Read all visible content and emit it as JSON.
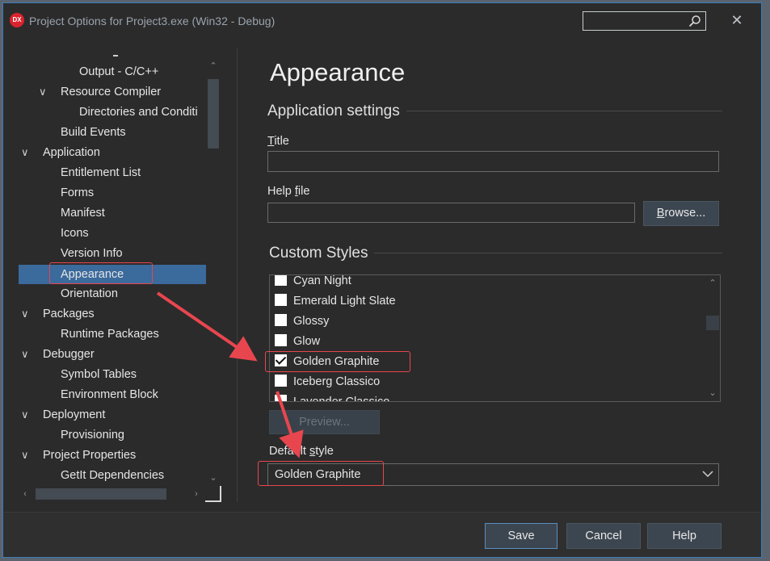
{
  "window": {
    "title": "Project Options for Project3.exe  (Win32 - Debug)",
    "app_icon_text": "DX",
    "close_symbol": "✕"
  },
  "tree": {
    "items": [
      {
        "label": "Output - C/C++",
        "level": 2,
        "expanded": null
      },
      {
        "label": "Resource Compiler",
        "level": 1,
        "expanded": true
      },
      {
        "label": "Directories and Conditi",
        "level": 2,
        "expanded": null
      },
      {
        "label": "Build Events",
        "level": 1,
        "expanded": null
      },
      {
        "label": "Application",
        "level": 0,
        "expanded": true
      },
      {
        "label": "Entitlement List",
        "level": 1,
        "expanded": null
      },
      {
        "label": "Forms",
        "level": 1,
        "expanded": null
      },
      {
        "label": "Manifest",
        "level": 1,
        "expanded": null
      },
      {
        "label": "Icons",
        "level": 1,
        "expanded": null
      },
      {
        "label": "Version Info",
        "level": 1,
        "expanded": null
      },
      {
        "label": "Appearance",
        "level": 1,
        "expanded": null,
        "selected": true
      },
      {
        "label": "Orientation",
        "level": 1,
        "expanded": null
      },
      {
        "label": "Packages",
        "level": 0,
        "expanded": true
      },
      {
        "label": "Runtime Packages",
        "level": 1,
        "expanded": null
      },
      {
        "label": "Debugger",
        "level": 0,
        "expanded": true
      },
      {
        "label": "Symbol Tables",
        "level": 1,
        "expanded": null
      },
      {
        "label": "Environment Block",
        "level": 1,
        "expanded": null
      },
      {
        "label": "Deployment",
        "level": 0,
        "expanded": true
      },
      {
        "label": "Provisioning",
        "level": 1,
        "expanded": null
      },
      {
        "label": "Project Properties",
        "level": 0,
        "expanded": true
      },
      {
        "label": "GetIt Dependencies",
        "level": 1,
        "expanded": null
      }
    ]
  },
  "main": {
    "heading": "Appearance",
    "app_settings": {
      "group_label": "Application settings",
      "title_label_accel": "T",
      "title_label_rest": "itle",
      "title_value": "",
      "helpfile_label_pre": "Help ",
      "helpfile_label_accel": "f",
      "helpfile_label_rest": "ile",
      "helpfile_value": "",
      "browse_label_accel": "B",
      "browse_label_rest": "rowse..."
    },
    "custom_styles": {
      "group_label": "Custom Styles",
      "items": [
        {
          "label": "Cyan Night",
          "checked": false
        },
        {
          "label": "Emerald Light Slate",
          "checked": false
        },
        {
          "label": "Glossy",
          "checked": false
        },
        {
          "label": "Glow",
          "checked": false
        },
        {
          "label": "Golden Graphite",
          "checked": true
        },
        {
          "label": "Iceberg Classico",
          "checked": false
        },
        {
          "label": "Lavender Classico",
          "checked": false
        }
      ],
      "preview_label": "Preview..."
    },
    "default_style": {
      "label_pre": "Default ",
      "label_accel": "s",
      "label_rest": "tyle",
      "selected": "Golden Graphite"
    }
  },
  "footer": {
    "save_label": "Save",
    "cancel_label": "Cancel",
    "help_label": "Help"
  },
  "colors": {
    "background": "#2b2b2b",
    "selection": "#3b6a9c",
    "annotation": "#e8464f",
    "accent_border": "#3d7bb8"
  }
}
